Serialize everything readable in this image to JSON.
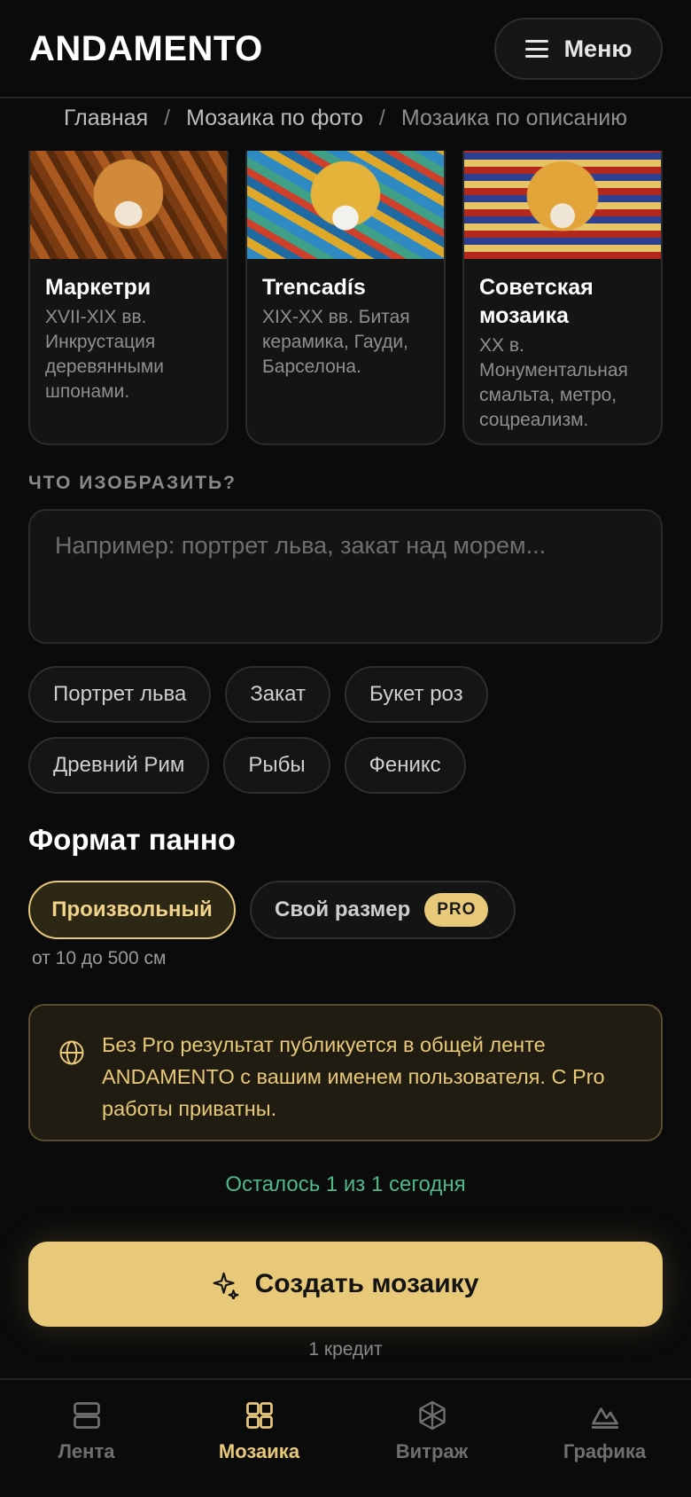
{
  "header": {
    "logo": "ANDAMENTO",
    "menu_label": "Меню"
  },
  "breadcrumb": {
    "items": [
      "Главная",
      "Мозаика по фото",
      "Мозаика по описанию"
    ],
    "separator": "/"
  },
  "styles": [
    {
      "title": "Маркетри",
      "desc": "XVII-XIX вв. Инкрустация деревянными шпонами."
    },
    {
      "title": "Trencadís",
      "desc": "XIX-XX вв. Битая керамика, Гауди, Барселона."
    },
    {
      "title": "Советская мозаика",
      "desc": "XX в. Монументальная смальта, метро, соцреализм."
    }
  ],
  "prompt": {
    "label": "ЧТО ИЗОБРАЗИТЬ?",
    "placeholder": "Например: портрет льва, закат над морем..."
  },
  "suggestions": {
    "row1": [
      "Портрет льва",
      "Закат",
      "Букет роз"
    ],
    "row2": [
      "Древний Рим",
      "Рыбы",
      "Феникс"
    ]
  },
  "format": {
    "title": "Формат панно",
    "options": [
      "Произвольный",
      "Свой размер"
    ],
    "pro_badge": "PRO",
    "hint": "от 10 до 500 см"
  },
  "notice": {
    "icon": "globe-icon",
    "text": "Без Pro результат публикуется в общей ленте ANDAMENTO с вашим именем пользователя. С Pro работы приватны."
  },
  "remaining": "Осталось 1 из 1 сегодня",
  "create": {
    "label": "Создать мозаику",
    "icon": "sparkle-icon",
    "cost": "1 кредит"
  },
  "nav": {
    "items": [
      "Лента",
      "Мозаика",
      "Витраж",
      "Графика"
    ],
    "active": "Мозаика"
  },
  "colors": {
    "accent": "#e8c97a",
    "success": "#4fb88a",
    "background": "#0b0b0b"
  }
}
